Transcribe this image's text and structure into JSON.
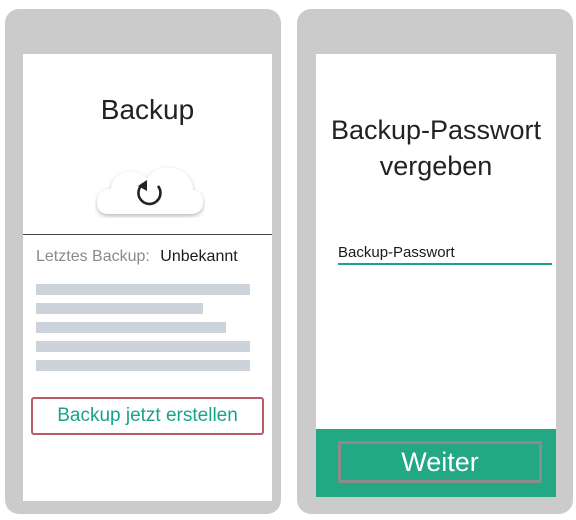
{
  "left_screen": {
    "title": "Backup",
    "cloud_icon": "cloud-sync-icon",
    "last_backup_label": "Letztes Backup:",
    "last_backup_value": "Unbekannt",
    "create_backup_label": "Backup jetzt erstellen"
  },
  "right_screen": {
    "title_line1": "Backup-Passwort",
    "title_line2": "vergeben",
    "password_field_label": "Backup-Passwort",
    "next_button_label": "Weiter"
  },
  "colors": {
    "accent": "#19a38a",
    "bar": "#23a884",
    "highlight_border": "#b85a6a",
    "phone_frame": "#cbcbcb"
  }
}
